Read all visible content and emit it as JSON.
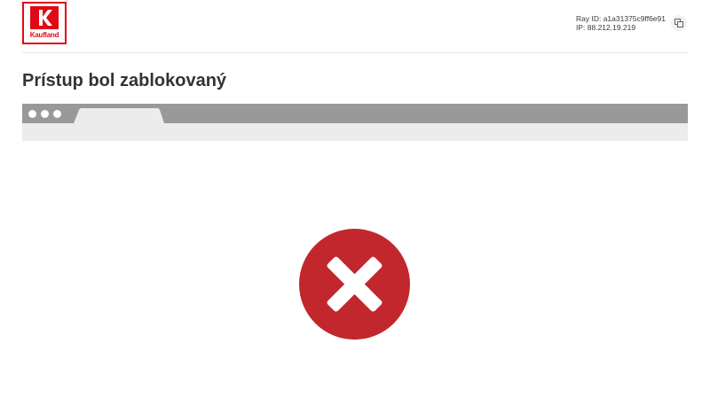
{
  "header": {
    "logo": {
      "brand_text": "Kaufland",
      "mark": "K",
      "color": "#e10915"
    },
    "ray_id_line": "Ray ID: a1a31375c9ff6e91",
    "ip_line": "IP: 88.212.19.219",
    "copy_icon": "copy-icon"
  },
  "main": {
    "title": "Prístup bol zablokovaný",
    "illustration": {
      "type": "browser-window",
      "bar_color": "#999999",
      "body_color": "#ececec",
      "tab_count": 1
    },
    "status_icon": {
      "name": "error-x-icon",
      "color": "#c1272d"
    }
  }
}
